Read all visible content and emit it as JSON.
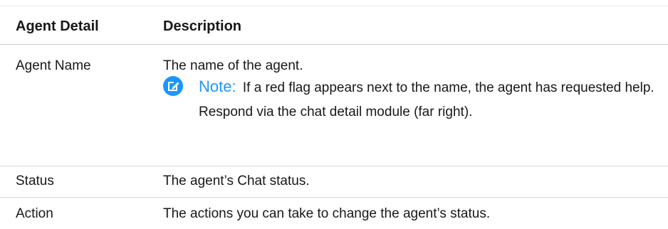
{
  "table": {
    "headers": {
      "col1": "Agent Detail",
      "col2": "Description"
    },
    "rows": [
      {
        "detail": "Agent Name",
        "description": "The name of the agent.",
        "note": {
          "label": "Note:",
          "text": "If a red flag appears next to the name, the agent has requested help. Respond via the chat detail module (far right).",
          "icon": "edit-note-icon"
        }
      },
      {
        "detail": "Status",
        "description": "The agent’s Chat status."
      },
      {
        "detail": "Action",
        "description": "The actions you can take to change the agent’s status."
      }
    ]
  },
  "colors": {
    "note_accent": "#1b96ff",
    "text": "#181818",
    "rule": "#d8d8d8"
  }
}
